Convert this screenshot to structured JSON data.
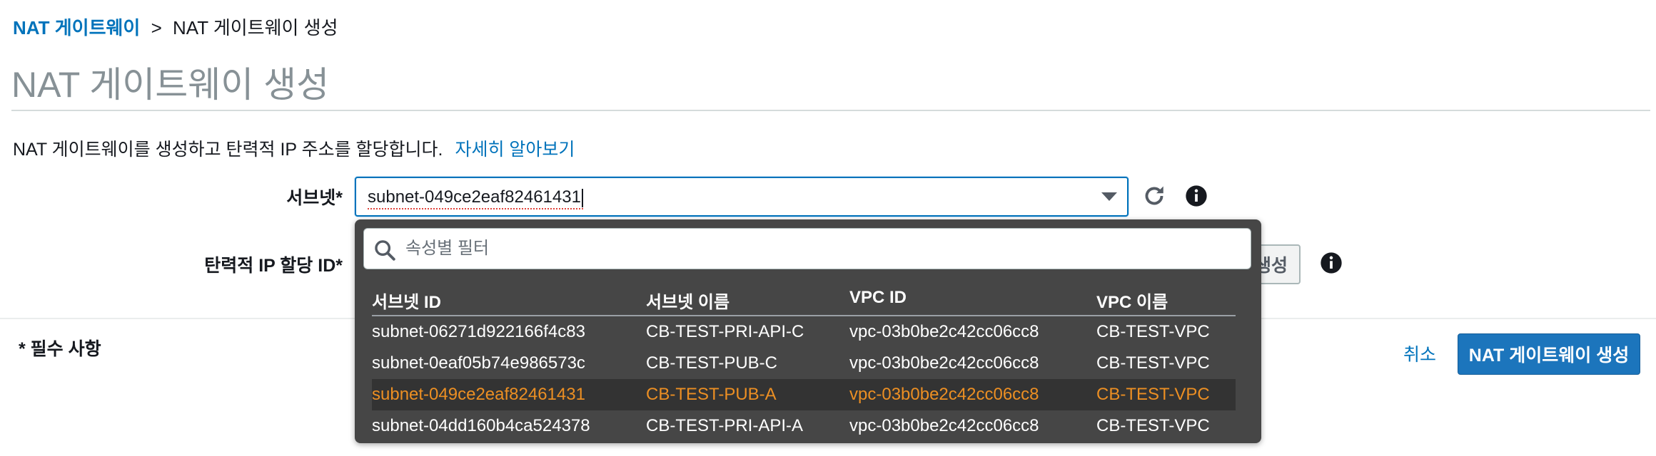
{
  "breadcrumb": {
    "parent": "NAT 게이트웨이",
    "separator": ">",
    "current": "NAT 게이트웨이 생성"
  },
  "page_title": "NAT 게이트웨이 생성",
  "description": {
    "text": "NAT 게이트웨이를 생성하고 탄력적 IP 주소를 할당합니다.",
    "learn_more": "자세히 알아보기"
  },
  "form": {
    "subnet_label": "서브넷*",
    "subnet_value": "subnet-049ce2eaf82461431",
    "eip_label": "탄력적 IP 할당 ID*",
    "eip_create_button_visible_text": "생성"
  },
  "dropdown": {
    "filter_placeholder": "속성별 필터",
    "columns": [
      "서브넷 ID",
      "서브넷 이름",
      "VPC ID",
      "VPC 이름"
    ],
    "rows": [
      {
        "subnet_id": "subnet-06271d922166f4c83",
        "subnet_name": "CB-TEST-PRI-API-C",
        "vpc_id": "vpc-03b0be2c42cc06cc8",
        "vpc_name": "CB-TEST-VPC",
        "selected": false
      },
      {
        "subnet_id": "subnet-0eaf05b74e986573c",
        "subnet_name": "CB-TEST-PUB-C",
        "vpc_id": "vpc-03b0be2c42cc06cc8",
        "vpc_name": "CB-TEST-VPC",
        "selected": false
      },
      {
        "subnet_id": "subnet-049ce2eaf82461431",
        "subnet_name": "CB-TEST-PUB-A",
        "vpc_id": "vpc-03b0be2c42cc06cc8",
        "vpc_name": "CB-TEST-VPC",
        "selected": true
      },
      {
        "subnet_id": "subnet-04dd160b4ca524378",
        "subnet_name": "CB-TEST-PRI-API-A",
        "vpc_id": "vpc-03b0be2c42cc06cc8",
        "vpc_name": "CB-TEST-VPC",
        "selected": false
      }
    ]
  },
  "footer": {
    "required_note": "* 필수 사항",
    "cancel_label": "취소",
    "create_label": "NAT 게이트웨이 생성"
  },
  "icons": {
    "refresh": "refresh-icon",
    "info": "info-icon",
    "search": "search-icon",
    "dropdown": "chevron-down-icon"
  },
  "colors": {
    "link": "#0073bb",
    "primary_button": "#1c75bc",
    "selected_row_text": "#ec8f23",
    "dropdown_bg": "#464646"
  }
}
